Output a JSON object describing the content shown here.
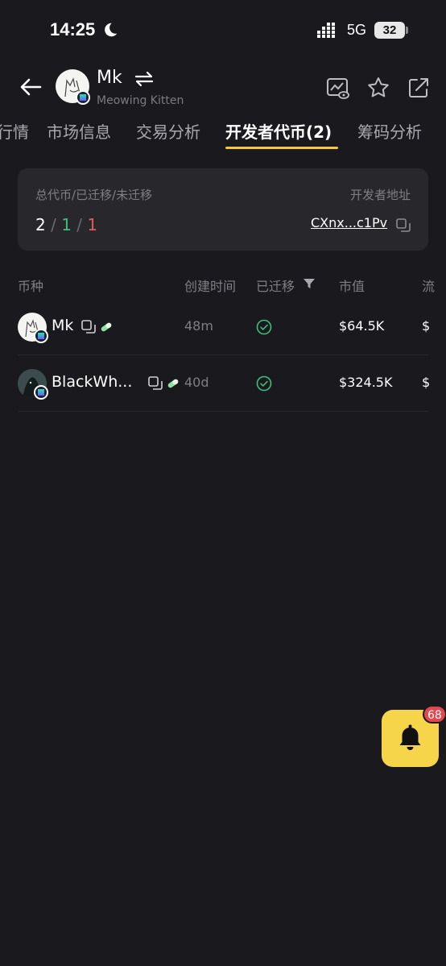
{
  "status_bar": {
    "time": "14:25",
    "network": "5G",
    "battery": "32"
  },
  "header": {
    "coin_name": "Mk",
    "coin_subtitle": "Meowing Kitten"
  },
  "tabs": [
    {
      "label": "行情"
    },
    {
      "label": "市场信息"
    },
    {
      "label": "交易分析"
    },
    {
      "label": "开发者代币(2)"
    },
    {
      "label": "筹码分析"
    }
  ],
  "summary": {
    "counts_label": "总代币/已迁移/未迁移",
    "address_label": "开发者地址",
    "total": "2",
    "migrated": "1",
    "unmigrated": "1",
    "separator": " / ",
    "address": "CXnx...c1Pv"
  },
  "table": {
    "headers": {
      "coin": "币种",
      "created": "创建时间",
      "migrated": "已迁移",
      "mcap": "市值",
      "extra": "流"
    },
    "rows": [
      {
        "name": "Mk",
        "time": "48m",
        "mcap": "$64.5K",
        "extra": "$"
      },
      {
        "name": "BlackWh...",
        "time": "40d",
        "mcap": "$324.5K",
        "extra": "$"
      }
    ]
  },
  "notification": {
    "badge": "68"
  },
  "colors": {
    "accent": "#f5c842",
    "migrated_green": "#3dbf7a",
    "unmigrated_red": "#e05a5a",
    "bell_yellow": "#f6d54a"
  }
}
